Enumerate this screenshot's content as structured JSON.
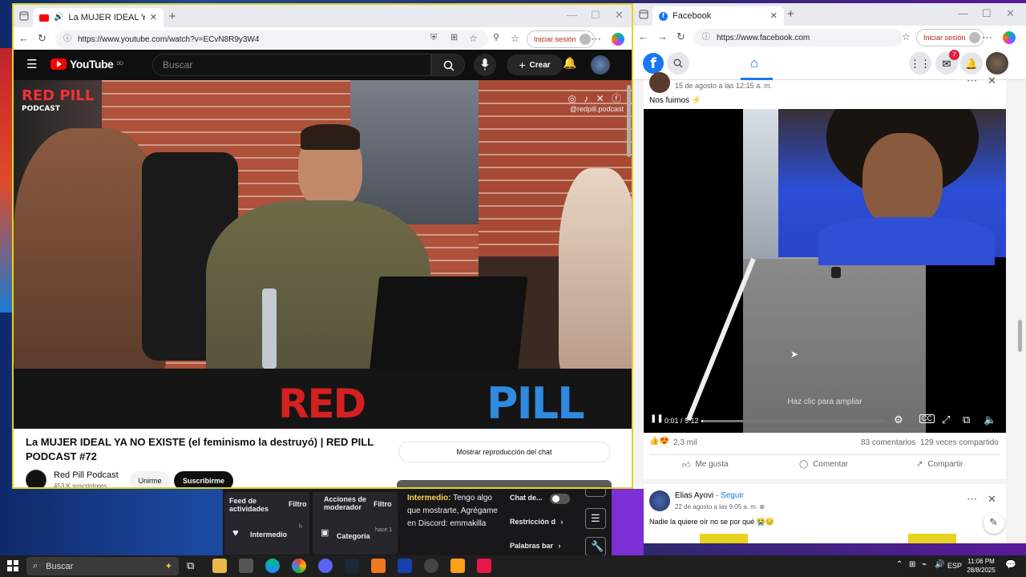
{
  "youtube_window": {
    "tab_title": "La MUJER IDEAL YA NO EXIST",
    "url": "https://www.youtube.com/watch?v=ECvN8R9y3W4",
    "signin_label": "Iniciar sesión",
    "logo_text": "YouTube",
    "logo_region": "DO",
    "search_placeholder": "Buscar",
    "create_label": "Crear",
    "video": {
      "brand": "RED PILL",
      "brand_sub": "PODCAST",
      "handle": "@redpill.podcast",
      "set_text_red": "RED",
      "set_text_blue": "PILL"
    },
    "video_title": "La MUJER IDEAL YA NO EXISTE (el feminismo la destruyó) | RED PILL PODCAST #72",
    "channel_name": "Red Pill Podcast",
    "channel_subs": "453 K suscriptores",
    "join_label": "Unirme",
    "subscribe_label": "Suscribirme",
    "show_chat_label": "Mostrar reproducción del chat"
  },
  "facebook_window": {
    "tab_title": "Facebook",
    "url": "https://www.facebook.com",
    "signin_label": "Iniciar sesión",
    "notification_count": "7",
    "post1": {
      "date": "15 de agosto a las 12:15 a. m.",
      "text": "Nos fuimos ⚡",
      "overlay_text": "Haz clic para ampliar",
      "time": "0:01 / 5:12",
      "progress": 0.01,
      "reactions_count": "2,3 mil",
      "comments": "83 comentarios",
      "shares": "129 veces compartido",
      "like_label": "Me gusta",
      "comment_label": "Comentar",
      "share_label": "Compartir"
    },
    "post2": {
      "author": "Elias Ayovi",
      "follow_label": "Seguir",
      "date": "22 de agosto a las 9:05 a. m.",
      "text": "Nadie la quiere oír no se por qué 😭😔"
    }
  },
  "stream_panel": {
    "feed_label": "Feed de actividades",
    "filter_label": "Filtro",
    "mod_actions_label": "Acciones de moderador",
    "filter2_label": "Filtro",
    "intermediate_label": "Intermedio",
    "intermediate_short": "h",
    "category_label": "Categoría",
    "category_time": "hace 1",
    "chat_msg_label": "Intermedio:",
    "chat_msg": "Tengo algo que mostrarte, Agrégame en Discord: emmakilla",
    "chat_setting": "Chat de...",
    "restriction_label": "Restricción d",
    "banned_words_label": "Palabras bar"
  },
  "taskbar": {
    "search_label": "Buscar",
    "language": "ESP",
    "time": "11:06 PM",
    "date": "28/8/2025"
  }
}
